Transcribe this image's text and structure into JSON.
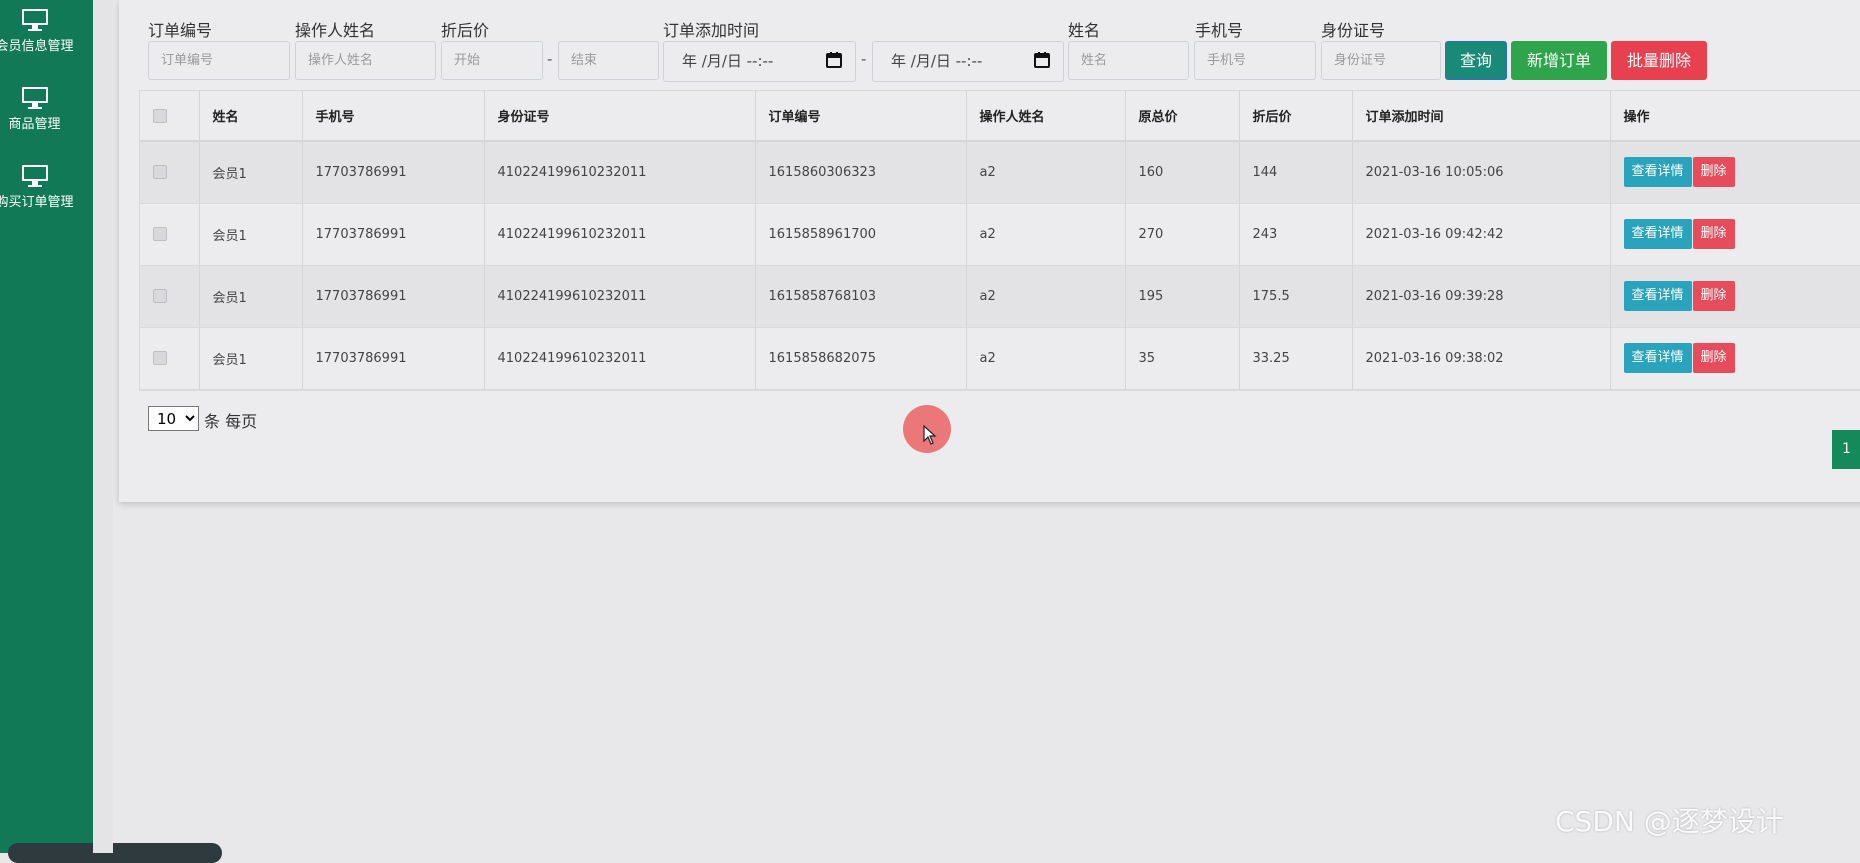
{
  "sidebar": {
    "items": [
      {
        "label": "会员信息管理",
        "icon": "monitor-icon"
      },
      {
        "label": "商品管理",
        "icon": "monitor-icon"
      },
      {
        "label": "购买订单管理",
        "icon": "monitor-icon"
      }
    ]
  },
  "filters": {
    "order_no": {
      "label": "订单编号",
      "placeholder": "订单编号"
    },
    "operator": {
      "label": "操作人姓名",
      "placeholder": "操作人姓名"
    },
    "discount_price": {
      "label": "折后价",
      "start_placeholder": "开始",
      "end_placeholder": "结束",
      "separator": "-"
    },
    "added_time": {
      "label": "订单添加时间",
      "start_value": "年 /月/日 --:--",
      "end_value": "年 /月/日 --:--",
      "separator": "-"
    },
    "name": {
      "label": "姓名",
      "placeholder": "姓名"
    },
    "phone": {
      "label": "手机号",
      "placeholder": "手机号"
    },
    "id_card": {
      "label": "身份证号",
      "placeholder": "身份证号"
    }
  },
  "buttons": {
    "query": "查询",
    "add_order": "新增订单",
    "batch_delete": "批量删除"
  },
  "colors": {
    "sidebar_bg": "#127957",
    "query_btn": "#1a8a78",
    "add_btn": "#2ea54a",
    "delete_btn": "#e8404f",
    "view_btn": "#2aa4bc"
  },
  "table": {
    "headers": [
      "姓名",
      "手机号",
      "身份证号",
      "订单编号",
      "操作人姓名",
      "原总价",
      "折后价",
      "订单添加时间",
      "操作"
    ],
    "rows": [
      {
        "name": "会员1",
        "phone": "17703786991",
        "id_card": "410224199610232011",
        "order_no": "1615860306323",
        "operator": "a2",
        "original_total": "160",
        "discounted": "144",
        "added_time": "2021-03-16 10:05:06"
      },
      {
        "name": "会员1",
        "phone": "17703786991",
        "id_card": "410224199610232011",
        "order_no": "1615858961700",
        "operator": "a2",
        "original_total": "270",
        "discounted": "243",
        "added_time": "2021-03-16 09:42:42"
      },
      {
        "name": "会员1",
        "phone": "17703786991",
        "id_card": "410224199610232011",
        "order_no": "1615858768103",
        "operator": "a2",
        "original_total": "195",
        "discounted": "175.5",
        "added_time": "2021-03-16 09:39:28"
      },
      {
        "name": "会员1",
        "phone": "17703786991",
        "id_card": "410224199610232011",
        "order_no": "1615858682075",
        "operator": "a2",
        "original_total": "35",
        "discounted": "33.25",
        "added_time": "2021-03-16 09:38:02"
      }
    ],
    "row_actions": {
      "view": "查看详情",
      "delete": "删除"
    }
  },
  "pagination": {
    "page_size": "10",
    "page_size_suffix": "条 每页",
    "current_page": "1"
  },
  "watermark": "CSDN @逐梦设计"
}
